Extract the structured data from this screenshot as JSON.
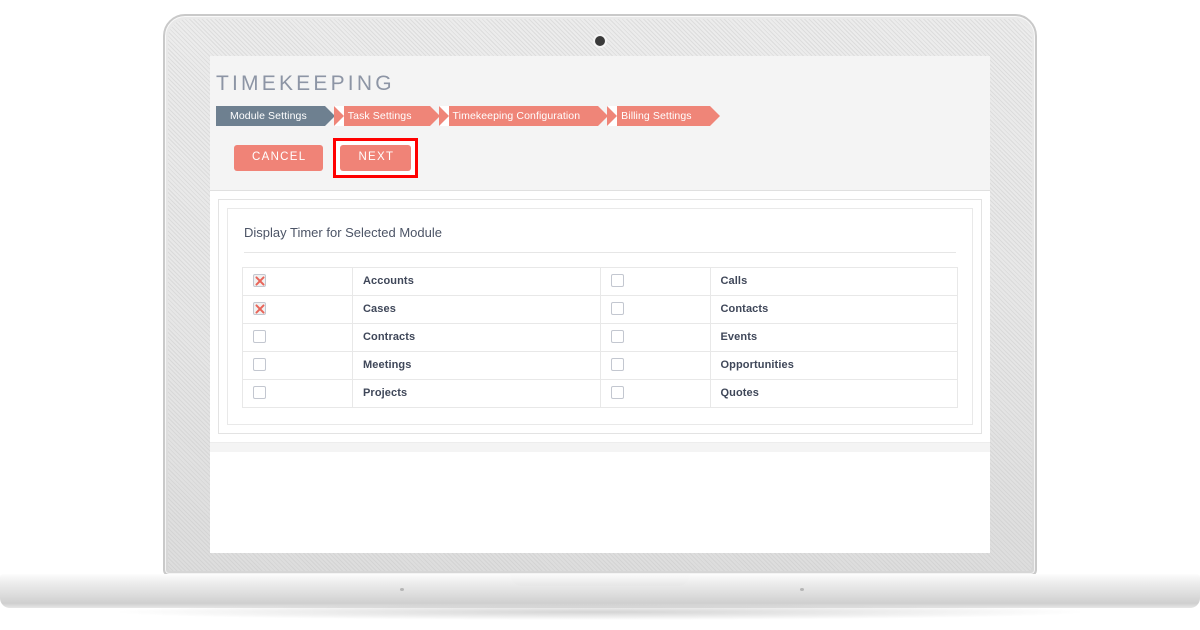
{
  "device": {
    "type": "laptop-mockup",
    "webcam": "webcam-dot"
  },
  "app": {
    "page_title": "TIMEKEEPING",
    "title_color": "#8d95a5",
    "accent_color": "#f08377",
    "active_step_color": "#6e8090",
    "highlight_color": "#ff0000"
  },
  "wizard": {
    "steps": [
      {
        "label": "Module Settings",
        "state": "active"
      },
      {
        "label": "Task Settings",
        "state": "pending"
      },
      {
        "label": "Timekeeping Configuration",
        "state": "pending"
      },
      {
        "label": "Billing Settings",
        "state": "pending"
      }
    ]
  },
  "actions": {
    "cancel_label": "CANCEL",
    "next_label": "NEXT",
    "next_highlighted": true
  },
  "panel": {
    "title": "Display Timer for Selected Module",
    "rows": [
      {
        "left": {
          "label": "Accounts",
          "checked": true
        },
        "right": {
          "label": "Calls",
          "checked": false
        }
      },
      {
        "left": {
          "label": "Cases",
          "checked": true
        },
        "right": {
          "label": "Contacts",
          "checked": false
        }
      },
      {
        "left": {
          "label": "Contracts",
          "checked": false
        },
        "right": {
          "label": "Events",
          "checked": false
        }
      },
      {
        "left": {
          "label": "Meetings",
          "checked": false
        },
        "right": {
          "label": "Opportunities",
          "checked": false
        }
      },
      {
        "left": {
          "label": "Projects",
          "checked": false
        },
        "right": {
          "label": "Quotes",
          "checked": false
        }
      }
    ]
  }
}
